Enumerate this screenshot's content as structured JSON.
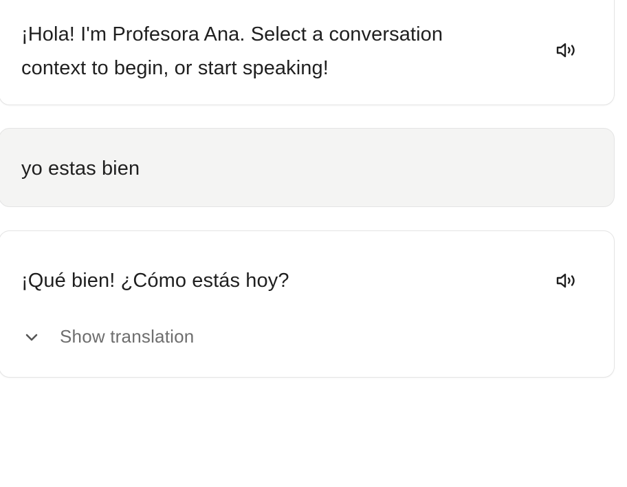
{
  "messages": [
    {
      "role": "assistant",
      "text": "¡Hola! I'm Profesora Ana. Select a conversation context to begin, or start speaking!",
      "speaker_icon": "speaker-icon"
    },
    {
      "role": "user",
      "text": "yo estas bien"
    },
    {
      "role": "assistant",
      "text": "¡Qué bien! ¿Cómo estás hoy?",
      "speaker_icon": "speaker-icon",
      "translation_toggle_label": "Show translation",
      "translation_toggle_icon": "chevron-down-icon"
    }
  ]
}
